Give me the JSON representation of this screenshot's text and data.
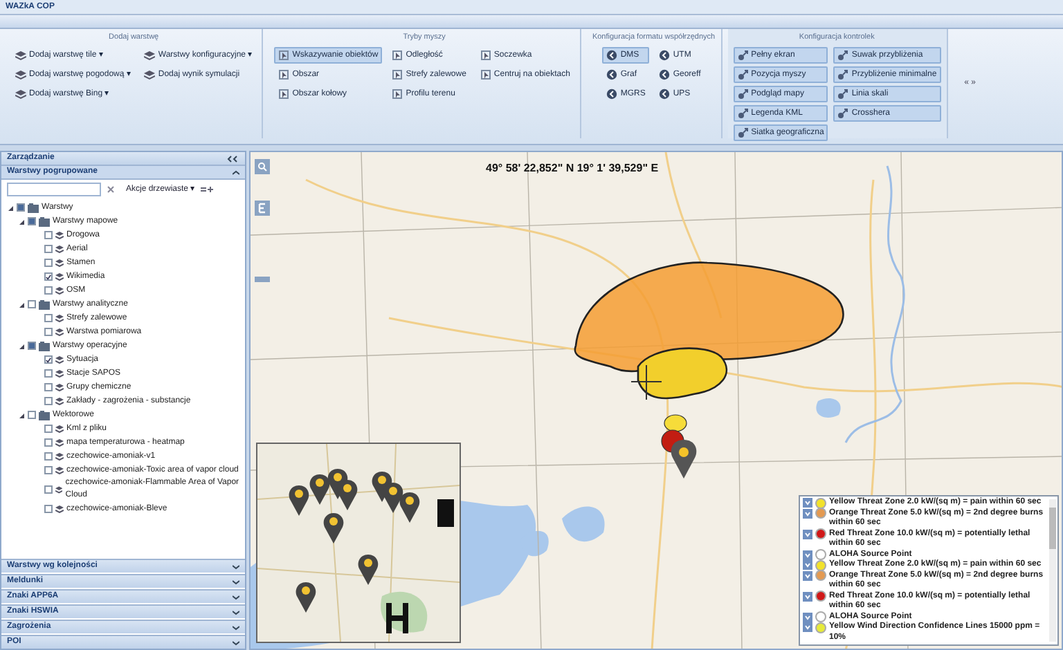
{
  "window": {
    "title": "WAZkA COP"
  },
  "ribbon": {
    "groups": [
      {
        "kind": "layers",
        "title": "Dodaj warstwę",
        "columns": [
          [
            {
              "label": "Dodaj warstwę tile ▾"
            },
            {
              "label": "Dodaj warstwę pogodową ▾"
            },
            {
              "label": "Dodaj warstwę Bing ▾"
            }
          ],
          [
            {
              "label": "Warstwy konfiguracyjne ▾"
            },
            {
              "label": "Dodaj wynik symulacji"
            }
          ]
        ]
      },
      {
        "kind": "mouse",
        "title": "Tryby myszy",
        "columns": [
          [
            {
              "label": "Wskazywanie obiektów",
              "selected": true
            },
            {
              "label": "Obszar",
              "selected": false
            },
            {
              "label": "Obszar kołowy",
              "selected": false
            }
          ],
          [
            {
              "label": "Odległość",
              "selected": false
            },
            {
              "label": "Strefy zalewowe",
              "selected": false
            },
            {
              "label": "Profilu terenu",
              "selected": false
            }
          ],
          [
            {
              "label": "Soczewka",
              "selected": false
            },
            {
              "label": "Centruj na obiektach",
              "selected": false
            }
          ]
        ]
      },
      {
        "kind": "coords",
        "title": "Konfiguracja formatu współrzędnych",
        "columns": [
          [
            {
              "label": "DMS",
              "selected": true
            },
            {
              "label": "Graf",
              "selected": false
            },
            {
              "label": "MGRS",
              "selected": false
            }
          ],
          [
            {
              "label": "UTM",
              "selected": false
            },
            {
              "label": "Georeff",
              "selected": false
            },
            {
              "label": "UPS",
              "selected": false
            }
          ]
        ]
      },
      {
        "kind": "controls",
        "title": "Konfiguracja kontrolek",
        "columns": [
          [
            {
              "label": "Pełny ekran",
              "on": true
            },
            {
              "label": "Pozycja myszy",
              "on": true
            },
            {
              "label": "Podgląd mapy",
              "on": true
            },
            {
              "label": "Legenda KML",
              "on": true
            },
            {
              "label": "Siatka geograficzna",
              "on": true
            }
          ],
          [
            {
              "label": "Suwak przybliżenia",
              "on": true
            },
            {
              "label": "Przybliżenie minimalne",
              "on": true
            },
            {
              "label": "Linia skali",
              "on": true
            },
            {
              "label": "Crosshera",
              "on": true
            }
          ]
        ]
      }
    ],
    "overflow": "« »"
  },
  "sidebar": {
    "title": "Zarządzanie",
    "section": "Warstwy pogrupowane",
    "tree_actions": "Akcje drzewiaste ▾",
    "tree": [
      {
        "label": "Warstwy",
        "checked": false,
        "partial": true,
        "expanded": true,
        "children": [
          {
            "label": "Warstwy mapowe",
            "checked": false,
            "partial": true,
            "expanded": true,
            "children": [
              {
                "label": "Drogowa",
                "checked": false
              },
              {
                "label": "Aerial",
                "checked": false
              },
              {
                "label": "Stamen",
                "checked": false
              },
              {
                "label": "Wikimedia",
                "checked": true
              },
              {
                "label": "OSM",
                "checked": false
              }
            ]
          },
          {
            "label": "Warstwy analityczne",
            "checked": false,
            "partial": false,
            "expanded": true,
            "children": [
              {
                "label": "Strefy zalewowe",
                "checked": false
              },
              {
                "label": "Warstwa pomiarowa",
                "checked": false
              }
            ]
          },
          {
            "label": "Warstwy operacyjne",
            "checked": false,
            "partial": true,
            "expanded": true,
            "children": [
              {
                "label": "Sytuacja",
                "checked": true
              },
              {
                "label": "Stacje SAPOS",
                "checked": false
              },
              {
                "label": "Grupy chemiczne",
                "checked": false
              },
              {
                "label": "Zakłady - zagrożenia - substancje",
                "checked": false
              }
            ]
          },
          {
            "label": "Wektorowe",
            "checked": false,
            "partial": false,
            "expanded": true,
            "children": [
              {
                "label": "Kml z pliku",
                "checked": false
              },
              {
                "label": "mapa temperaturowa - heatmap",
                "checked": false
              },
              {
                "label": "czechowice-amoniak-v1",
                "checked": false
              },
              {
                "label": "czechowice-amoniak-Toxic area of vapor cloud",
                "checked": false
              },
              {
                "label": "czechowice-amoniak-Flammable Area of Vapor Cloud",
                "checked": false
              },
              {
                "label": "czechowice-amoniak-Bleve",
                "checked": false
              }
            ]
          }
        ]
      }
    ],
    "panels": [
      "Warstwy wg kolejności",
      "Meldunki",
      "Znaki APP6A",
      "Znaki HSWIA",
      "Zagrożenia",
      "POI"
    ]
  },
  "map": {
    "coordinates": "49° 58' 22,852\" N 19° 1' 39,529\" E",
    "legend": [
      {
        "text": "Yellow Threat Zone 2.0 kW/(sq m) = pain within 60 sec",
        "color": "#f2e22c"
      },
      {
        "text": "Orange Threat Zone 5.0 kW/(sq m) = 2nd degree burns within 60 sec",
        "color": "#e39a52"
      },
      {
        "text": "Red Threat Zone 10.0 kW/(sq m) = potentially lethal within 60 sec",
        "color": "#d01818"
      },
      {
        "text": "ALOHA Source Point",
        "color": "#ffffff"
      },
      {
        "text": "Yellow Threat Zone 2.0 kW/(sq m) = pain within 60 sec",
        "color": "#f2e22c"
      },
      {
        "text": "Orange Threat Zone 5.0 kW/(sq m) = 2nd degree burns within 60 sec",
        "color": "#e39a52"
      },
      {
        "text": "Red Threat Zone 10.0 kW/(sq m) = potentially lethal within 60 sec",
        "color": "#d01818"
      },
      {
        "text": "ALOHA Source Point",
        "color": "#ffffff"
      },
      {
        "text": "Yellow Wind Direction Confidence Lines 15000 ppm = 10%",
        "color": "#e6ea3a"
      }
    ]
  }
}
